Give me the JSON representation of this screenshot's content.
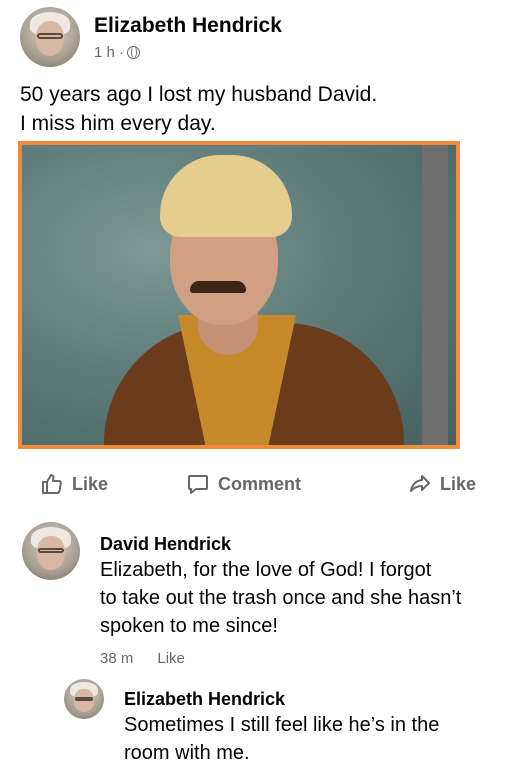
{
  "post": {
    "author": "Elizabeth Hendrick",
    "time": "1 h ·",
    "privacy_icon": "globe-icon",
    "text_lines": [
      "50 years ago I lost my husband David.",
      "I miss him every day."
    ],
    "photo_border_color": "#f08a3c"
  },
  "actions": {
    "like_label": "Like",
    "comment_label": "Comment",
    "share_label": "Like"
  },
  "comments": [
    {
      "author": "David Hendrick",
      "text_lines": [
        "Elizabeth, for the love of God! I forgot",
        "to take out the trash once and she hasn’t",
        "spoken to me since!"
      ],
      "time": "38 m",
      "like_label": "Like"
    },
    {
      "author": "Elizabeth Hendrick",
      "text_lines": [
        "Sometimes I still feel like he’s in the",
        "room with me."
      ]
    }
  ]
}
